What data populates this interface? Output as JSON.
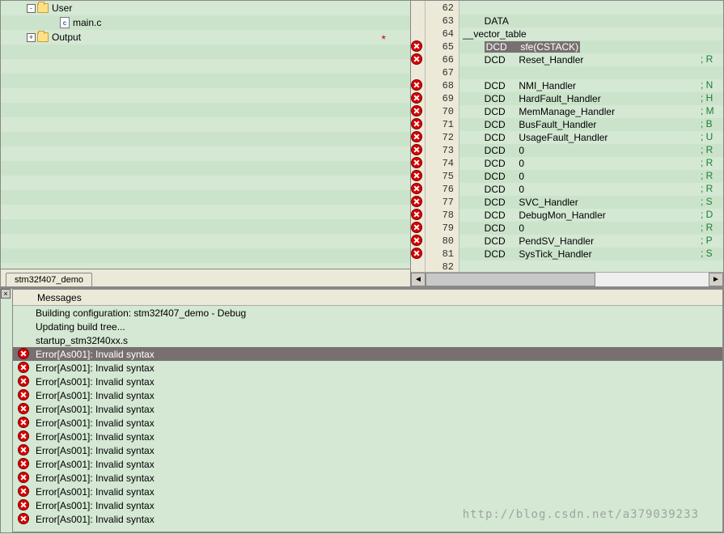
{
  "tree": {
    "items": [
      {
        "indent": 24,
        "exp": "-",
        "icon": "folder",
        "label": "User"
      },
      {
        "indent": 52,
        "exp": "",
        "icon": "file",
        "label": "main.c",
        "modified": true
      },
      {
        "indent": 24,
        "exp": "+",
        "icon": "folder",
        "label": "Output"
      }
    ],
    "star": "*"
  },
  "tab": {
    "label": "stm32f407_demo"
  },
  "code": {
    "lines": [
      {
        "n": 62,
        "err": false,
        "text": "",
        "right": ""
      },
      {
        "n": 63,
        "err": false,
        "text": "        DATA",
        "right": ""
      },
      {
        "n": 64,
        "err": false,
        "text": "__vector_table",
        "right": ""
      },
      {
        "n": 65,
        "err": true,
        "hl": true,
        "opc": "DCD",
        "arg": "sfe(CSTACK)",
        "right": ""
      },
      {
        "n": 66,
        "err": true,
        "opc": "DCD",
        "arg": "Reset_Handler",
        "right": "; R"
      },
      {
        "n": 67,
        "err": false,
        "text": "",
        "right": ""
      },
      {
        "n": 68,
        "err": true,
        "opc": "DCD",
        "arg": "NMI_Handler",
        "right": "; N"
      },
      {
        "n": 69,
        "err": true,
        "opc": "DCD",
        "arg": "HardFault_Handler",
        "right": "; H"
      },
      {
        "n": 70,
        "err": true,
        "opc": "DCD",
        "arg": "MemManage_Handler",
        "right": "; M"
      },
      {
        "n": 71,
        "err": true,
        "opc": "DCD",
        "arg": "BusFault_Handler",
        "right": "; B"
      },
      {
        "n": 72,
        "err": true,
        "opc": "DCD",
        "arg": "UsageFault_Handler",
        "right": "; U"
      },
      {
        "n": 73,
        "err": true,
        "opc": "DCD",
        "arg": "0",
        "right": "; R"
      },
      {
        "n": 74,
        "err": true,
        "opc": "DCD",
        "arg": "0",
        "right": "; R"
      },
      {
        "n": 75,
        "err": true,
        "opc": "DCD",
        "arg": "0",
        "right": "; R"
      },
      {
        "n": 76,
        "err": true,
        "opc": "DCD",
        "arg": "0",
        "right": "; R"
      },
      {
        "n": 77,
        "err": true,
        "opc": "DCD",
        "arg": "SVC_Handler",
        "right": "; S"
      },
      {
        "n": 78,
        "err": true,
        "opc": "DCD",
        "arg": "DebugMon_Handler",
        "right": "; D"
      },
      {
        "n": 79,
        "err": true,
        "opc": "DCD",
        "arg": "0",
        "right": "; R"
      },
      {
        "n": 80,
        "err": true,
        "opc": "DCD",
        "arg": "PendSV_Handler",
        "right": "; P"
      },
      {
        "n": 81,
        "err": true,
        "opc": "DCD",
        "arg": "SysTick_Handler",
        "right": "; S"
      },
      {
        "n": 82,
        "err": false,
        "text": "",
        "right": ""
      }
    ]
  },
  "messages": {
    "header": "Messages",
    "rows": [
      {
        "icon": "",
        "sel": false,
        "indent": false,
        "text": "Building configuration: stm32f407_demo - Debug"
      },
      {
        "icon": "",
        "sel": false,
        "indent": false,
        "text": "Updating build tree..."
      },
      {
        "icon": "",
        "sel": false,
        "indent": false,
        "text": "startup_stm32f40xx.s"
      },
      {
        "icon": "err",
        "sel": true,
        "indent": false,
        "text": "Error[As001]: Invalid syntax "
      },
      {
        "icon": "err",
        "sel": false,
        "indent": false,
        "text": "Error[As001]: Invalid syntax "
      },
      {
        "icon": "err",
        "sel": false,
        "indent": false,
        "text": "Error[As001]: Invalid syntax "
      },
      {
        "icon": "err",
        "sel": false,
        "indent": false,
        "text": "Error[As001]: Invalid syntax "
      },
      {
        "icon": "err",
        "sel": false,
        "indent": false,
        "text": "Error[As001]: Invalid syntax "
      },
      {
        "icon": "err",
        "sel": false,
        "indent": false,
        "text": "Error[As001]: Invalid syntax "
      },
      {
        "icon": "err",
        "sel": false,
        "indent": false,
        "text": "Error[As001]: Invalid syntax "
      },
      {
        "icon": "err",
        "sel": false,
        "indent": false,
        "text": "Error[As001]: Invalid syntax "
      },
      {
        "icon": "err",
        "sel": false,
        "indent": false,
        "text": "Error[As001]: Invalid syntax "
      },
      {
        "icon": "err",
        "sel": false,
        "indent": false,
        "text": "Error[As001]: Invalid syntax "
      },
      {
        "icon": "err",
        "sel": false,
        "indent": false,
        "text": "Error[As001]: Invalid syntax "
      },
      {
        "icon": "err",
        "sel": false,
        "indent": false,
        "text": "Error[As001]: Invalid syntax "
      },
      {
        "icon": "err",
        "sel": false,
        "indent": false,
        "text": "Error[As001]: Invalid syntax "
      }
    ]
  },
  "watermark": "http://blog.csdn.net/a379039233"
}
